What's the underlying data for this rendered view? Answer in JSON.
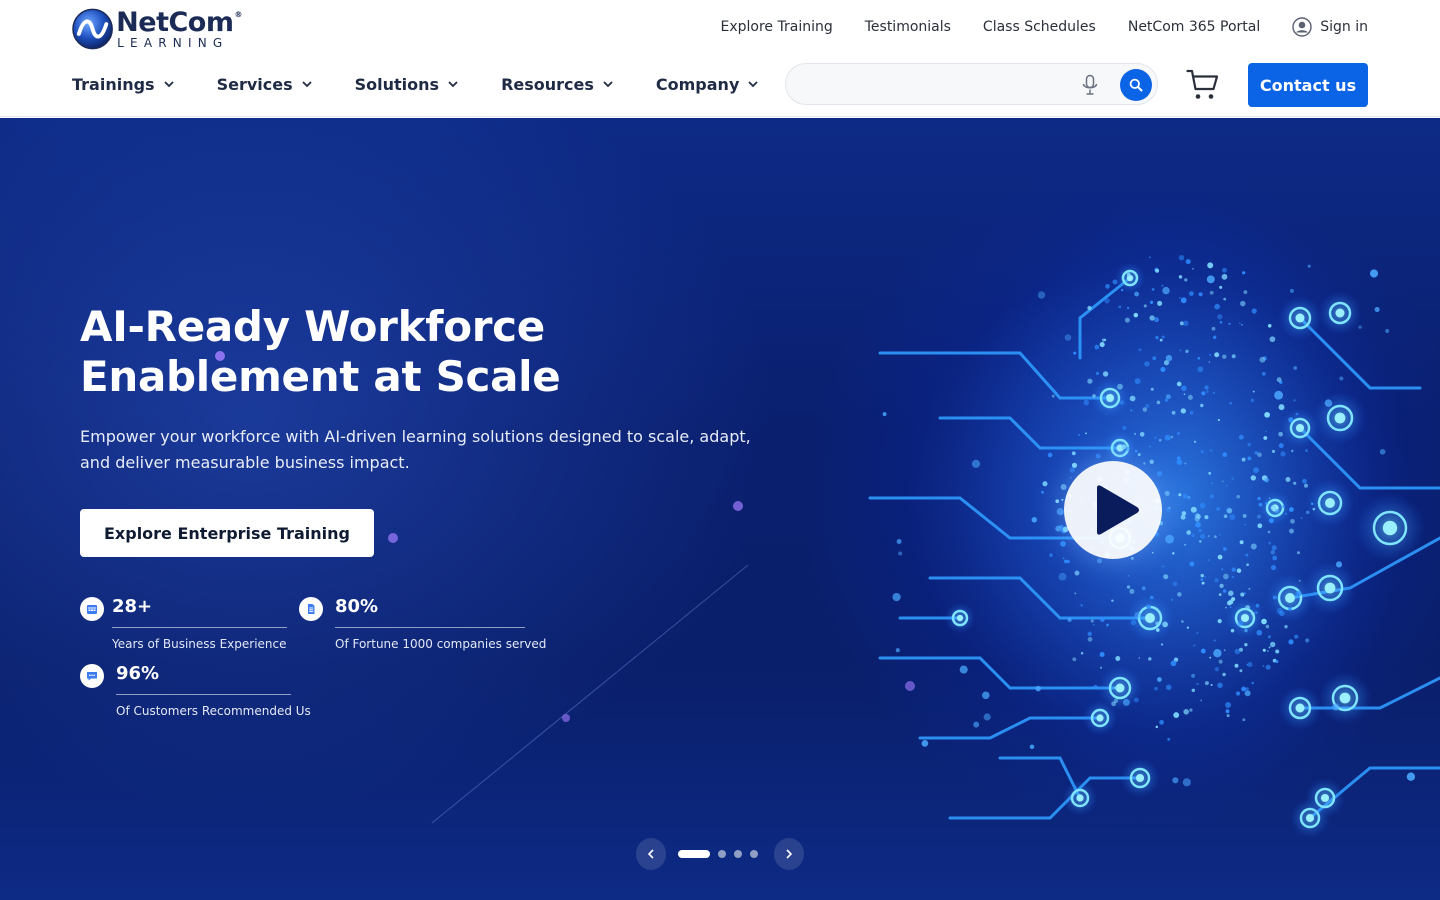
{
  "brand": {
    "name": "NetCom",
    "registered": "®",
    "sub": "LEARNING",
    "colors": {
      "primary": "#0b63e5",
      "navy": "#1b2b55",
      "hero_bg": "#0a1f6e"
    }
  },
  "top_links": {
    "items": [
      "Explore Training",
      "Testimonials",
      "Class Schedules",
      "NetCom 365 Portal"
    ],
    "sign_in": "Sign in"
  },
  "nav": {
    "items": [
      "Trainings",
      "Services",
      "Solutions",
      "Resources",
      "Company"
    ]
  },
  "search": {
    "value": "",
    "placeholder": ""
  },
  "header_actions": {
    "contact": "Contact us"
  },
  "hero": {
    "title_line1": "AI-Ready Workforce",
    "title_line2": "Enablement at Scale",
    "subtitle": "Empower your workforce with AI-driven learning solutions designed to scale, adapt, and deliver measurable business impact.",
    "cta": "Explore Enterprise Training",
    "stats": [
      {
        "value": "28+",
        "label": "Years of Business Experience",
        "icon": "calendar-icon"
      },
      {
        "value": "80%",
        "label": "Of Fortune 1000 companies served",
        "icon": "document-icon"
      },
      {
        "value": "96%",
        "label": "Of Customers Recommended Us",
        "icon": "chat-icon"
      }
    ]
  },
  "carousel": {
    "slides": 4,
    "active": 1
  },
  "icons": [
    "netcom-logo-icon",
    "user-circle-icon",
    "chevron-down-icon",
    "microphone-icon",
    "search-icon",
    "cart-icon",
    "play-icon",
    "chevron-left-icon",
    "chevron-right-icon"
  ]
}
